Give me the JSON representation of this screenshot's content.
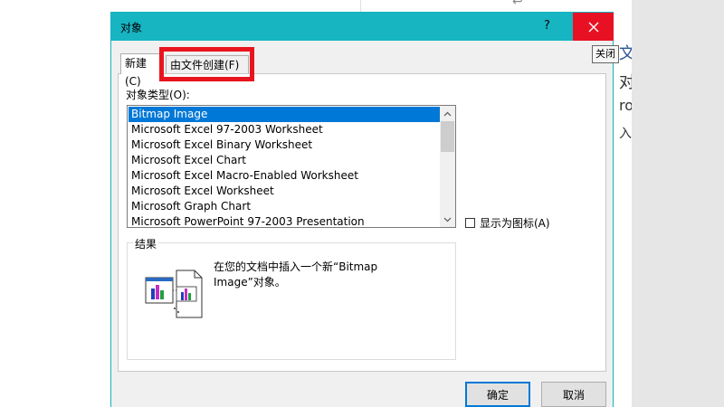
{
  "dialog": {
    "title": "对象",
    "help_label": "?",
    "close_tooltip": "关闭"
  },
  "tabs": {
    "new_label": "新建(C)",
    "from_file_label": "由文件创建(F)"
  },
  "object_type": {
    "label": "对象类型(O):",
    "items": [
      "Bitmap Image",
      "Microsoft Excel 97-2003 Worksheet",
      "Microsoft Excel Binary Worksheet",
      "Microsoft Excel Chart",
      "Microsoft Excel Macro-Enabled Worksheet",
      "Microsoft Excel Worksheet",
      "Microsoft Graph Chart",
      "Microsoft PowerPoint 97-2003 Presentation"
    ],
    "selected": "Bitmap Image"
  },
  "display_as_icon": {
    "label": "显示为图标(A)",
    "checked": false
  },
  "result": {
    "label": "结果",
    "text": "在您的文档中插入一个新“Bitmap Image”对象。"
  },
  "buttons": {
    "ok": "确定",
    "cancel": "取消"
  },
  "colors": {
    "titlebar": "#17b4c2",
    "close": "#e81123",
    "selection": "#0078d7",
    "highlight_box": "#e8141e"
  }
}
